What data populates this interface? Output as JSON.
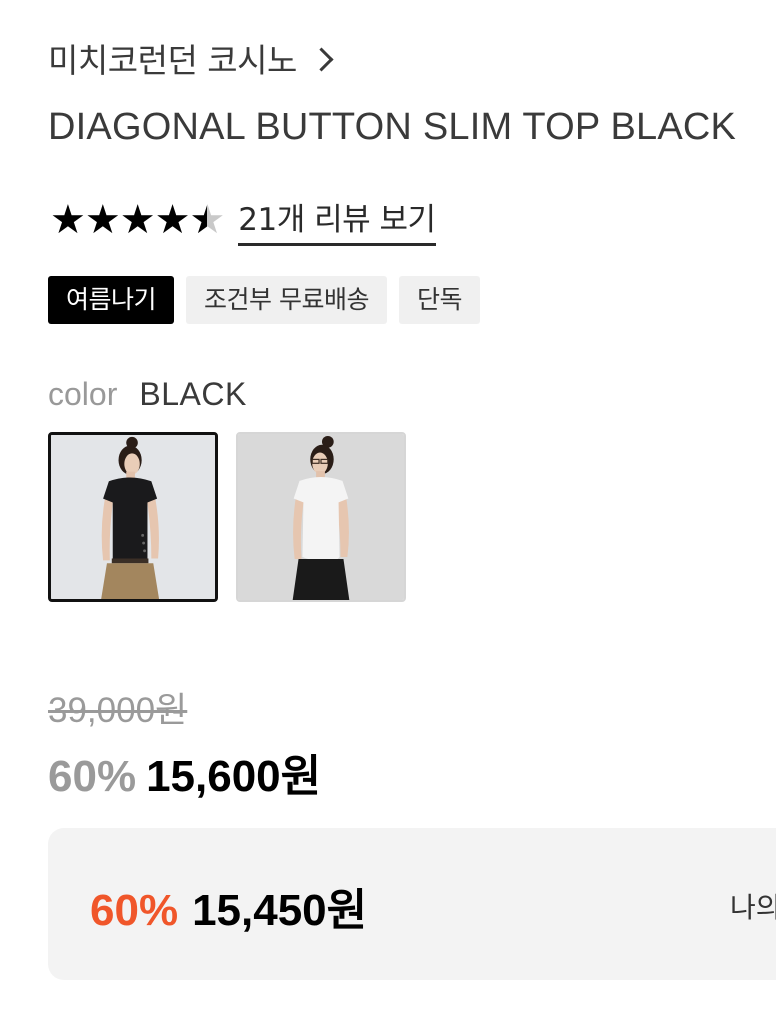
{
  "brand": {
    "name": "미치코런던 코시노",
    "chevron_icon": "chevron-right-icon"
  },
  "product": {
    "title": "DIAGONAL BUTTON SLIM TOP BLACK"
  },
  "rating": {
    "value": 4.5,
    "max": 5,
    "stars": "★★★★★",
    "review_link": "21개 리뷰 보기"
  },
  "tags": [
    {
      "label": "여름나기",
      "style": "dark"
    },
    {
      "label": "조건부 무료배송",
      "style": "light"
    },
    {
      "label": "단독",
      "style": "light"
    }
  ],
  "color": {
    "label": "color",
    "selected": "BLACK",
    "options": [
      {
        "name": "black-top-swatch",
        "selected": true
      },
      {
        "name": "white-top-swatch",
        "selected": false
      }
    ]
  },
  "price": {
    "original": "39,000원",
    "discount": "60%",
    "sale": "15,600원"
  },
  "member_price": {
    "discount": "60%",
    "price": "15,450원",
    "side_text": "나의"
  },
  "colors": {
    "accent": "#f0562a",
    "tag_dark_bg": "#000000",
    "tag_light_bg": "#f0f0f0",
    "muted_text": "#9a9a9a",
    "box_bg": "#f3f3f3"
  }
}
